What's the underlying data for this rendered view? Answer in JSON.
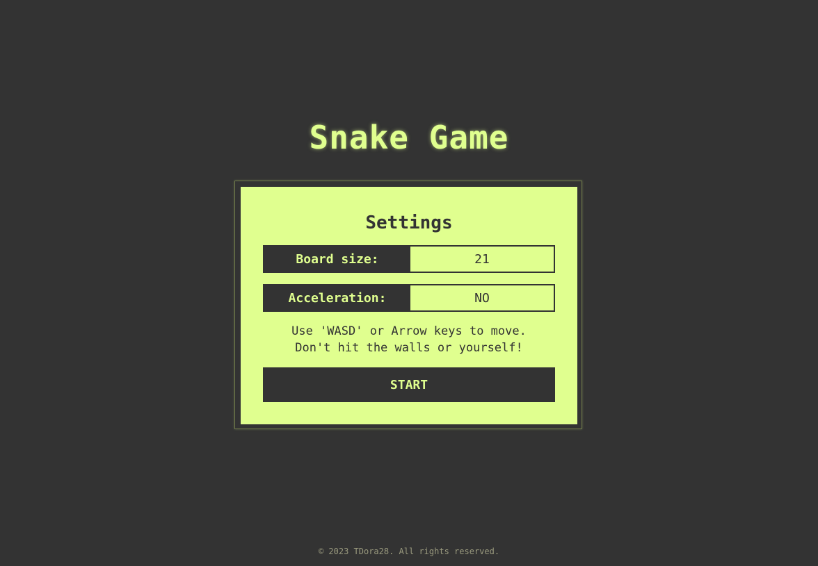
{
  "header": {
    "title": "Snake Game"
  },
  "settings": {
    "heading": "Settings",
    "board_size": {
      "label": "Board size:",
      "value": "21"
    },
    "acceleration": {
      "label": "Acceleration:",
      "value": "NO"
    },
    "instructions": {
      "line1": "Use 'WASD' or Arrow keys to move.",
      "line2": "Don't hit the walls or yourself!"
    },
    "start_label": "START"
  },
  "footer": {
    "copyright": "© 2023 TDora28. All rights reserved."
  },
  "colors": {
    "background": "#333333",
    "accent": "#e0ff8f"
  }
}
